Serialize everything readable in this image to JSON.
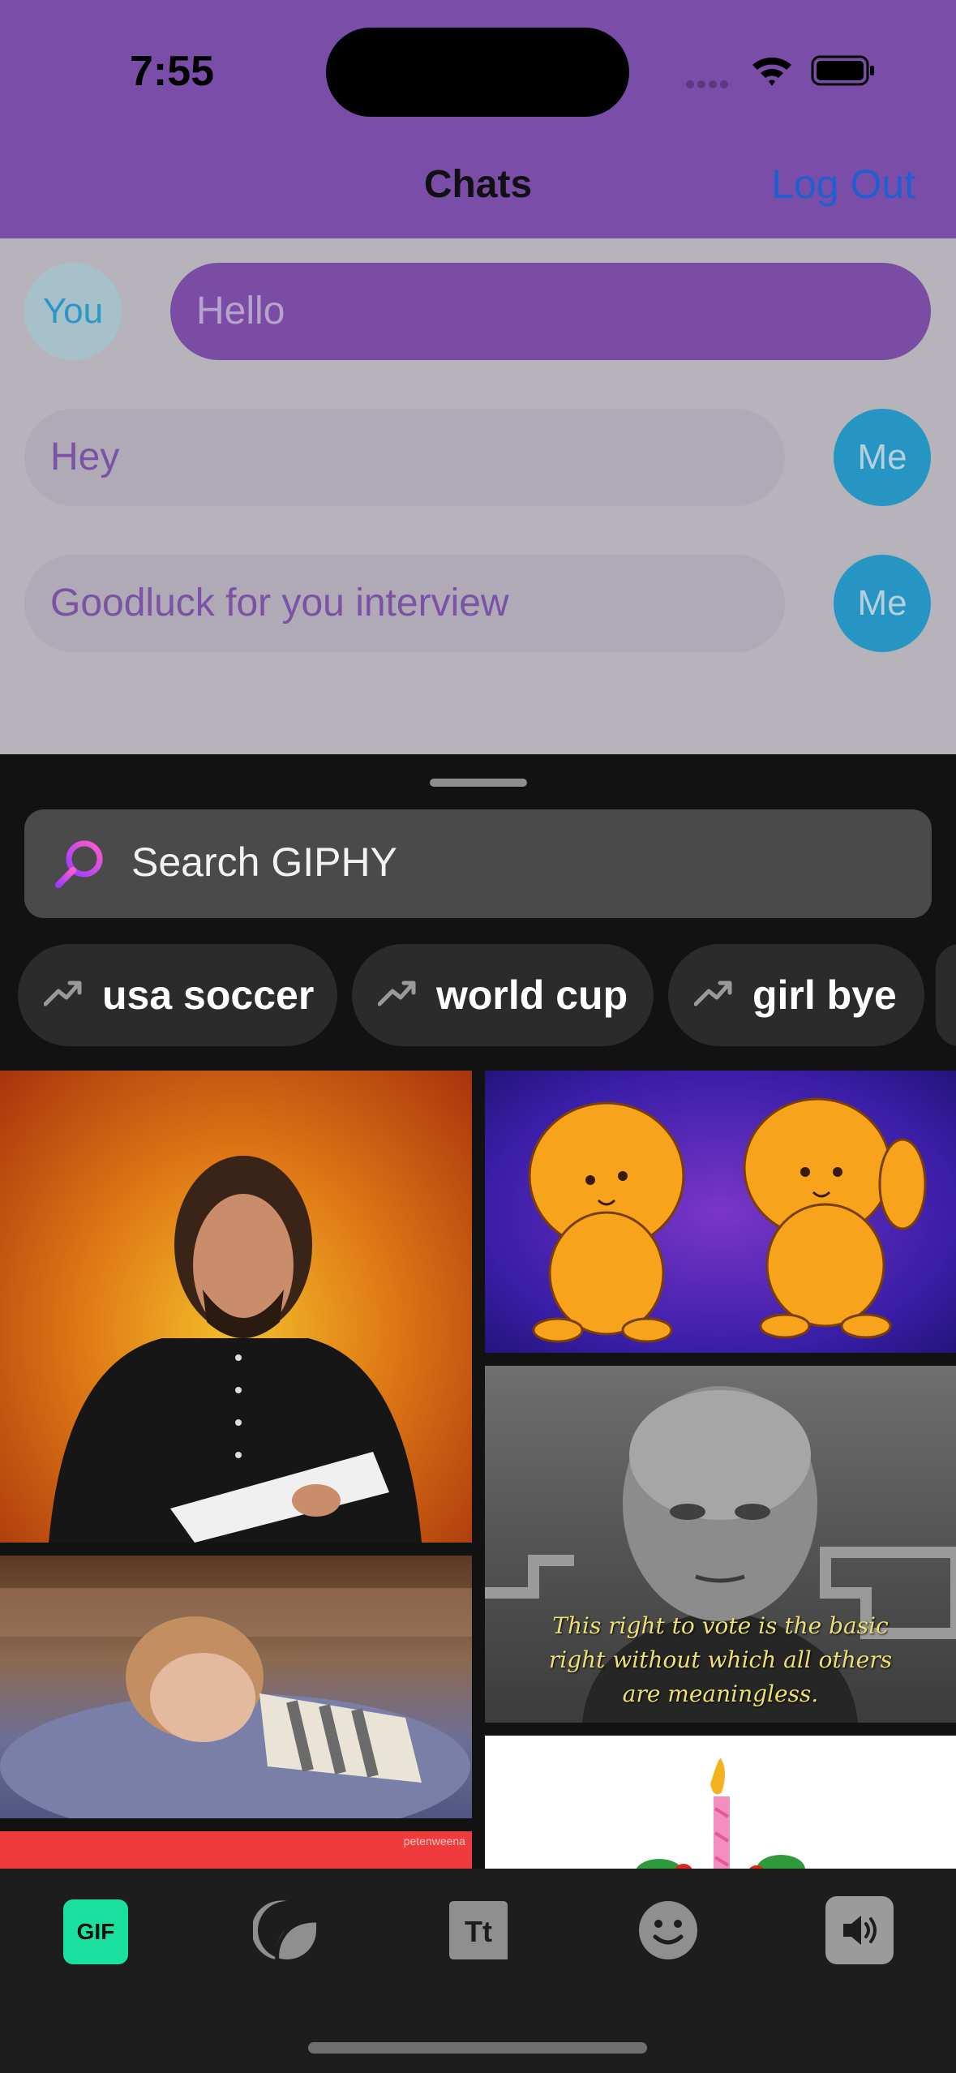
{
  "status_bar": {
    "time": "7:55"
  },
  "nav": {
    "title": "Chats",
    "logout_label": "Log Out"
  },
  "chat": {
    "incoming_avatar": "You",
    "incoming_message": "Hello",
    "outgoing": [
      {
        "avatar": "Me",
        "message": "Hey"
      },
      {
        "avatar": "Me",
        "message": "Goodluck for you interview"
      }
    ]
  },
  "giphy": {
    "search_placeholder": "Search GIPHY",
    "trending": [
      "usa soccer",
      "world cup",
      "girl bye"
    ],
    "captions": {
      "vote": "This right to vote is the basic right without which all others are meaningless.",
      "watermark": "petenweena"
    }
  },
  "toolbar": {
    "gif_label": "GIF",
    "items": [
      "gif-tab",
      "stickers-tab",
      "text-tab",
      "emoji-tab",
      "sound-toggle"
    ]
  },
  "colors": {
    "header_purple": "#7a4ea8",
    "logout_blue": "#1f5fd1",
    "gif_green": "#1ae0a0",
    "sheet_bg": "#121212"
  }
}
